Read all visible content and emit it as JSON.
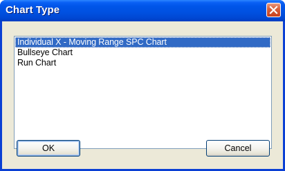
{
  "window": {
    "title": "Chart Type"
  },
  "list": {
    "items": [
      {
        "label": "Individual X - Moving Range SPC Chart",
        "selected": true
      },
      {
        "label": "Bullseye Chart",
        "selected": false
      },
      {
        "label": "Run Chart",
        "selected": false
      }
    ]
  },
  "buttons": {
    "ok_label": "OK",
    "cancel_label": "Cancel"
  },
  "colors": {
    "titlebar": "#0055e8",
    "selection": "#316ac5",
    "close_button": "#d8603c",
    "dialog_face": "#ece9d8"
  },
  "icons": {
    "close": "close-icon"
  }
}
